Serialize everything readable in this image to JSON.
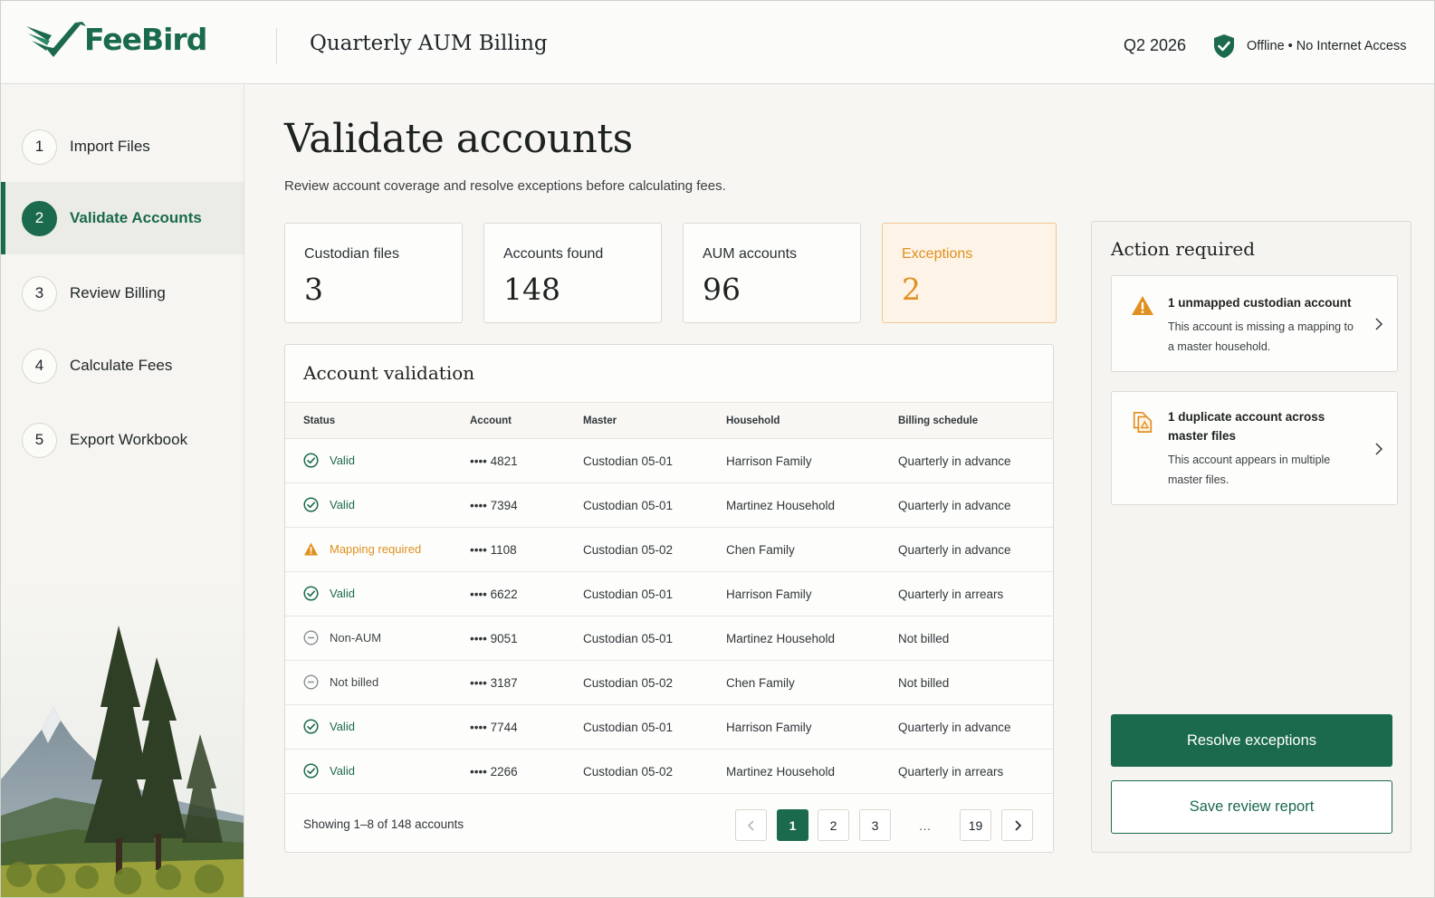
{
  "app": {
    "brand": "FeeBird",
    "title": "Quarterly AUM Billing",
    "quarter": "Q2 2026",
    "status": "Offline • No Internet Access"
  },
  "colors": {
    "brand": "#1b6a4d",
    "warning": "#e0901f",
    "background": "#f7f6f2"
  },
  "sidebar": {
    "steps": [
      {
        "num": "1",
        "label": "Import Files"
      },
      {
        "num": "2",
        "label": "Validate Accounts",
        "active": true
      },
      {
        "num": "3",
        "label": "Review Billing"
      },
      {
        "num": "4",
        "label": "Calculate Fees"
      },
      {
        "num": "5",
        "label": "Export Workbook"
      }
    ]
  },
  "main": {
    "title": "Validate accounts",
    "subtitle": "Review account coverage and resolve exceptions before calculating fees.",
    "stats": [
      {
        "label": "Custodian files",
        "value": "3"
      },
      {
        "label": "Accounts found",
        "value": "148"
      },
      {
        "label": "AUM accounts",
        "value": "96"
      },
      {
        "label": "Exceptions",
        "value": "2"
      }
    ]
  },
  "table": {
    "title": "Account validation",
    "columns": [
      "Status",
      "Account",
      "Master",
      "Household",
      "Billing schedule"
    ],
    "rows": [
      {
        "status": "Valid",
        "status_icon": "check-circle-icon",
        "account": "•••• 4821",
        "master": "Custodian 05-01",
        "household": "Harrison Family",
        "schedule": "Quarterly in advance"
      },
      {
        "status": "Valid",
        "status_icon": "check-circle-icon",
        "account": "•••• 7394",
        "master": "Custodian 05-01",
        "household": "Martinez Household",
        "schedule": "Quarterly in advance"
      },
      {
        "status": "Mapping required",
        "status_icon": "warning-triangle-icon",
        "account": "•••• 1108",
        "master": "Custodian 05-02",
        "household": "Chen Family",
        "schedule": "Quarterly in advance"
      },
      {
        "status": "Valid",
        "status_icon": "check-circle-icon",
        "account": "•••• 6622",
        "master": "Custodian 05-01",
        "household": "Harrison Family",
        "schedule": "Quarterly in arrears"
      },
      {
        "status": "Non-AUM",
        "status_icon": "minus-circle-icon",
        "account": "•••• 9051",
        "master": "Custodian 05-01",
        "household": "Martinez Household",
        "schedule": "Not billed"
      },
      {
        "status": "Not billed",
        "status_icon": "minus-circle-icon",
        "account": "•••• 3187",
        "master": "Custodian 05-02",
        "household": "Chen Family",
        "schedule": "Not billed"
      },
      {
        "status": "Valid",
        "status_icon": "check-circle-icon",
        "account": "•••• 7744",
        "master": "Custodian 05-01",
        "household": "Harrison Family",
        "schedule": "Quarterly in advance"
      },
      {
        "status": "Valid",
        "status_icon": "check-circle-icon",
        "account": "•••• 2266",
        "master": "Custodian 05-02",
        "household": "Martinez Household",
        "schedule": "Quarterly in arrears"
      }
    ],
    "footer": {
      "showing": "Showing 1–8 of 148 accounts",
      "pages": [
        "1",
        "2",
        "3",
        "…",
        "19"
      ],
      "current_page": "1"
    }
  },
  "actions": {
    "title": "Action required",
    "items": [
      {
        "icon": "warning-triangle-icon",
        "heading": "1 unmapped custodian account",
        "body": "This account is missing a mapping to a master household."
      },
      {
        "icon": "duplicate-file-icon",
        "heading": "1 duplicate account across master files",
        "body": "This account appears in multiple master files."
      }
    ],
    "primary_button": "Resolve exceptions",
    "secondary_button": "Save review report"
  }
}
